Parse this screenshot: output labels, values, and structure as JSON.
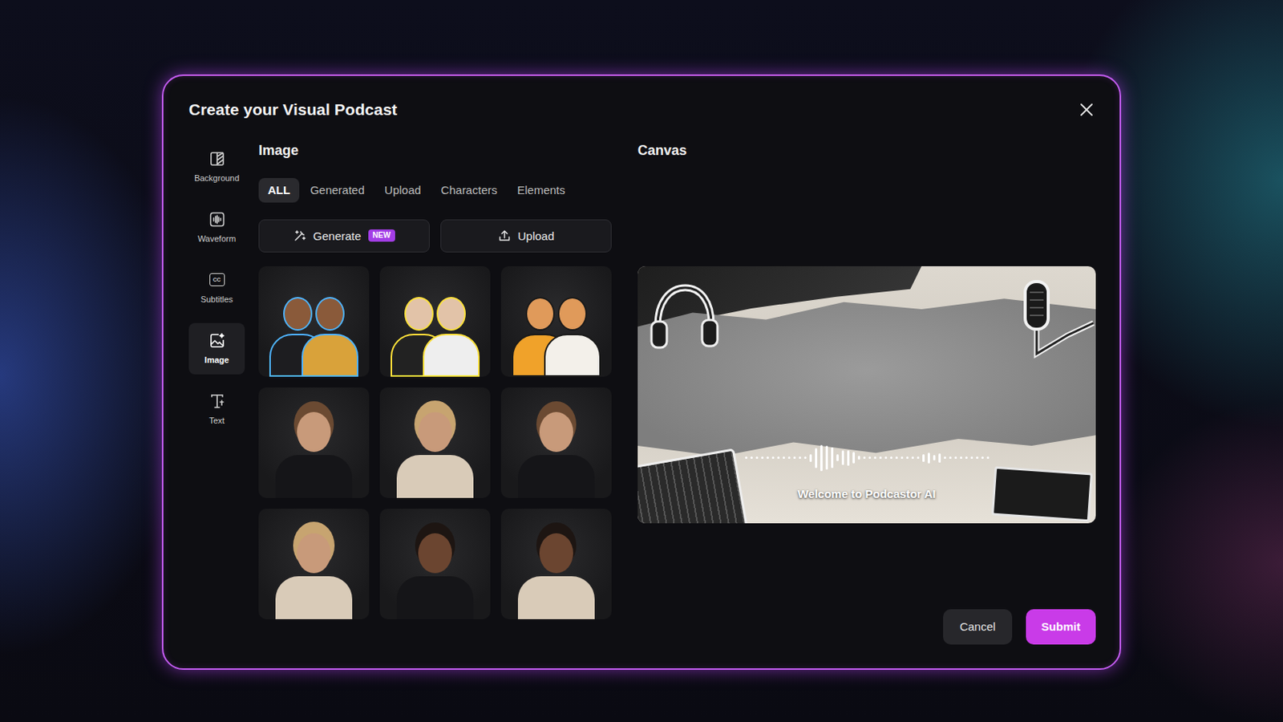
{
  "dialog": {
    "title": "Create your Visual Podcast"
  },
  "sidebar": {
    "items": [
      {
        "label": "Background",
        "kind": "background",
        "selected": false
      },
      {
        "label": "Waveform",
        "kind": "waveform",
        "selected": false
      },
      {
        "label": "Subtitles",
        "kind": "subtitles",
        "icon_text": "CC",
        "selected": false
      },
      {
        "label": "Image",
        "kind": "image",
        "selected": true
      },
      {
        "label": "Text",
        "kind": "text",
        "selected": false
      }
    ]
  },
  "image_panel": {
    "heading": "Image",
    "tabs": [
      {
        "label": "ALL",
        "selected": true
      },
      {
        "label": "Generated",
        "selected": false
      },
      {
        "label": "Upload",
        "selected": false
      },
      {
        "label": "Characters",
        "selected": false
      },
      {
        "label": "Elements",
        "selected": false
      }
    ],
    "actions": [
      {
        "label": "Generate",
        "badge": "NEW",
        "kind": "generate"
      },
      {
        "label": "Upload",
        "kind": "upload"
      }
    ],
    "images": [
      {
        "kind": "illustration"
      },
      {
        "kind": "illustration"
      },
      {
        "kind": "illustration"
      },
      {
        "kind": "photo"
      },
      {
        "kind": "photo"
      },
      {
        "kind": "photo"
      },
      {
        "kind": "photo"
      },
      {
        "kind": "photo"
      },
      {
        "kind": "photo"
      }
    ]
  },
  "canvas_panel": {
    "heading": "Canvas",
    "waveform": {
      "levels": [
        0.08,
        0.08,
        0.08,
        0.08,
        0.08,
        0.08,
        0.08,
        0.08,
        0.08,
        0.08,
        0.08,
        0.08,
        0.3,
        0.75,
        1,
        0.9,
        0.8,
        0.25,
        0.55,
        0.6,
        0.45,
        0.15,
        0.08,
        0.08,
        0.08,
        0.08,
        0.08,
        0.08,
        0.08,
        0.08,
        0.08,
        0.08,
        0.08,
        0.3,
        0.4,
        0.2,
        0.35,
        0.1,
        0.08,
        0.08,
        0.08,
        0.08,
        0.08,
        0.08,
        0.08,
        0.08
      ]
    },
    "subtitle": "Welcome to Podcastor AI"
  },
  "buttons": [
    {
      "label": "Cancel",
      "kind": "secondary"
    },
    {
      "label": "Submit",
      "kind": "primary"
    }
  ]
}
